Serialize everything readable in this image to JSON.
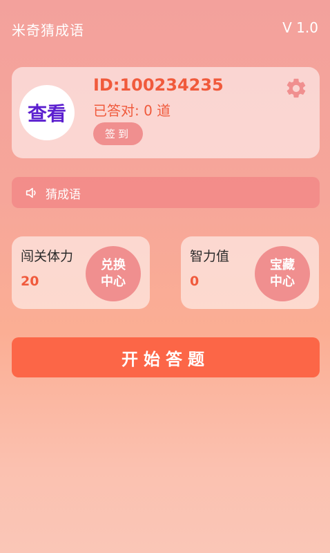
{
  "header": {
    "app_title": "米奇猜成语",
    "version": "V 1.0"
  },
  "profile": {
    "avatar_label": "查看",
    "id_text": "ID:100234235",
    "answered_text": "已答对: 0 道",
    "checkin_label": "签到",
    "settings_icon": "gear-icon"
  },
  "sound_bar": {
    "icon": "speaker-icon",
    "label": "猜成语"
  },
  "stats": {
    "stamina": {
      "title": "闯关体力",
      "value": "20",
      "button_line1": "兑换",
      "button_line2": "中心"
    },
    "intelligence": {
      "title": "智力值",
      "value": "0",
      "button_line1": "宝藏",
      "button_line2": "中心"
    }
  },
  "start_button": {
    "label": "开始答题"
  },
  "colors": {
    "accent": "#f05a3c",
    "start_button": "#fc6647",
    "pill": "#f08f8f",
    "avatar_text": "#5b1fcf"
  }
}
